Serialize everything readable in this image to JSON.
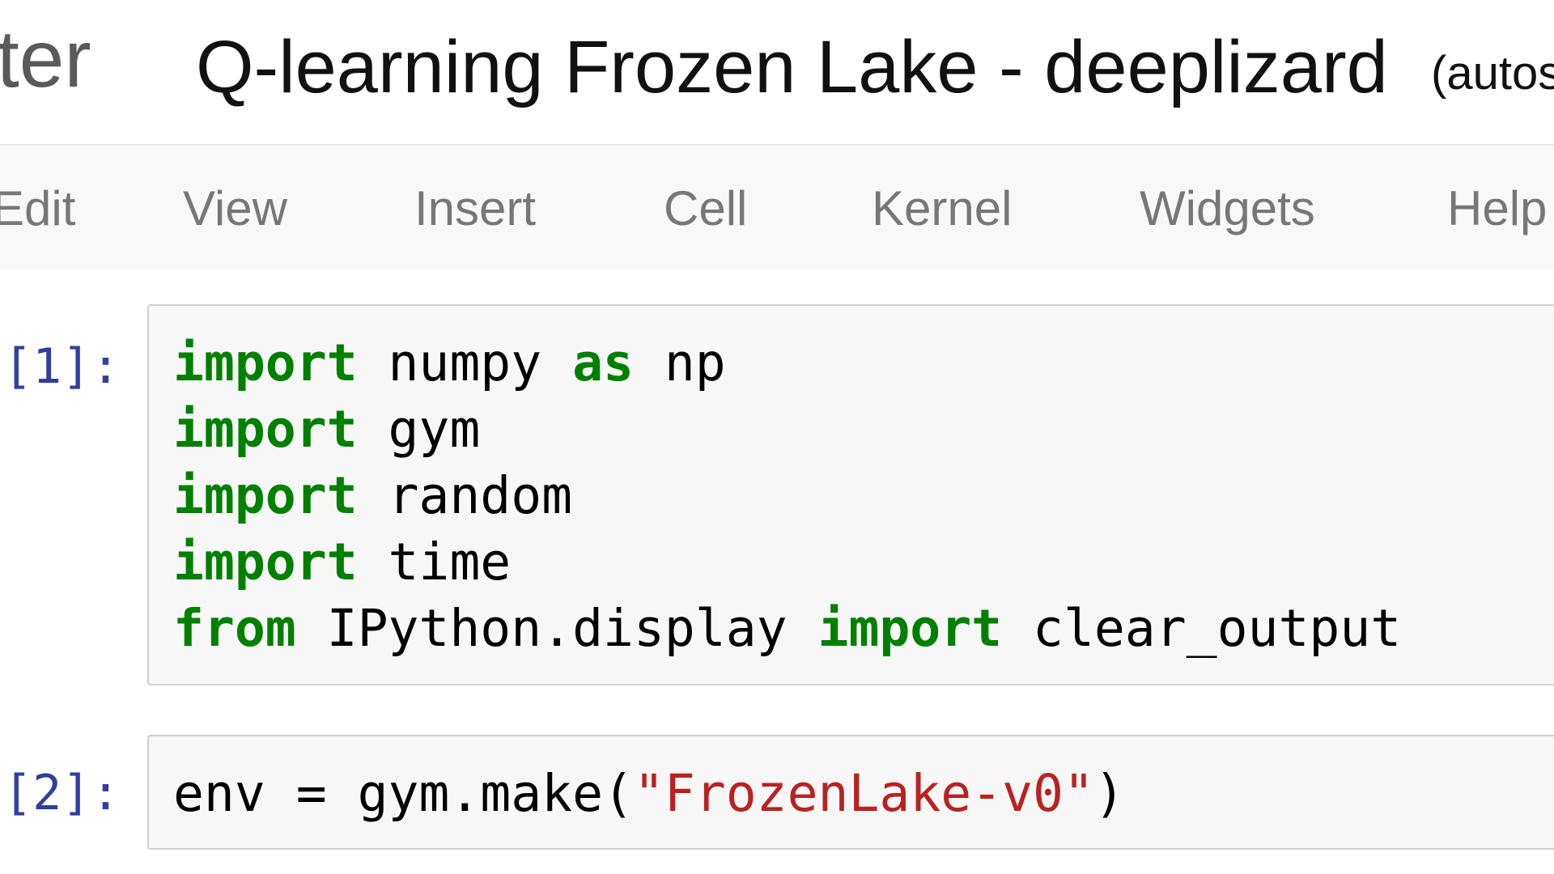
{
  "header": {
    "logo_text": "ter",
    "notebook_title": "Q-learning Frozen Lake - deeplizard",
    "autosave_text": "(autos"
  },
  "menubar": {
    "items": [
      {
        "label": "Edit"
      },
      {
        "label": "View"
      },
      {
        "label": "Insert"
      },
      {
        "label": "Cell"
      },
      {
        "label": "Kernel"
      },
      {
        "label": "Widgets"
      },
      {
        "label": "Help"
      }
    ]
  },
  "cells": [
    {
      "prompt": "[1]:",
      "lines": [
        [
          {
            "text": "import",
            "type": "kw"
          },
          {
            "text": " numpy ",
            "type": "plain"
          },
          {
            "text": "as",
            "type": "kw"
          },
          {
            "text": " np",
            "type": "plain"
          }
        ],
        [
          {
            "text": "import",
            "type": "kw"
          },
          {
            "text": " gym",
            "type": "plain"
          }
        ],
        [
          {
            "text": "import",
            "type": "kw"
          },
          {
            "text": " random",
            "type": "plain"
          }
        ],
        [
          {
            "text": "import",
            "type": "kw"
          },
          {
            "text": " time",
            "type": "plain"
          }
        ],
        [
          {
            "text": "from",
            "type": "kw"
          },
          {
            "text": " IPython.display ",
            "type": "plain"
          },
          {
            "text": "import",
            "type": "kw"
          },
          {
            "text": " clear_output",
            "type": "plain"
          }
        ]
      ]
    },
    {
      "prompt": "[2]:",
      "lines": [
        [
          {
            "text": "env = gym.make(",
            "type": "plain"
          },
          {
            "text": "\"FrozenLake-v0\"",
            "type": "str"
          },
          {
            "text": ")",
            "type": "plain"
          }
        ]
      ]
    }
  ],
  "colors": {
    "keyword": "#008000",
    "string": "#ba2121",
    "prompt": "#303f9f",
    "menu_text": "#777777"
  }
}
